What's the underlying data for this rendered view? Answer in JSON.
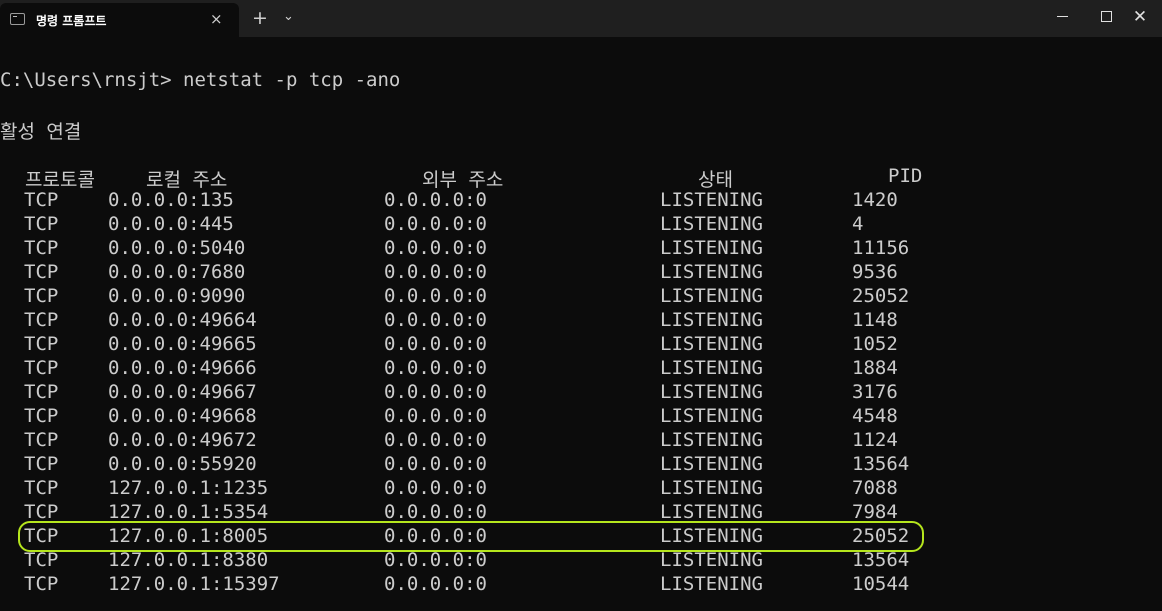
{
  "window": {
    "tab_title": "명령 프롬프트",
    "tab_close": "×",
    "new_tab": "+",
    "dropdown": "⌄",
    "minimize": "–",
    "maximize": "□",
    "close": "✕"
  },
  "terminal": {
    "command_line": "C:\\Users\\rnsjt> netstat -p tcp -ano",
    "section_title": "활성 연결",
    "headers": {
      "proto": "프로토콜",
      "local": "로컬 주소",
      "foreign": "외부 주소",
      "state": "상태",
      "pid": "PID"
    },
    "rows": [
      {
        "proto": "TCP",
        "local": "0.0.0.0:135",
        "foreign": "0.0.0.0:0",
        "state": "LISTENING",
        "pid": "1420"
      },
      {
        "proto": "TCP",
        "local": "0.0.0.0:445",
        "foreign": "0.0.0.0:0",
        "state": "LISTENING",
        "pid": "4"
      },
      {
        "proto": "TCP",
        "local": "0.0.0.0:5040",
        "foreign": "0.0.0.0:0",
        "state": "LISTENING",
        "pid": "11156"
      },
      {
        "proto": "TCP",
        "local": "0.0.0.0:7680",
        "foreign": "0.0.0.0:0",
        "state": "LISTENING",
        "pid": "9536"
      },
      {
        "proto": "TCP",
        "local": "0.0.0.0:9090",
        "foreign": "0.0.0.0:0",
        "state": "LISTENING",
        "pid": "25052"
      },
      {
        "proto": "TCP",
        "local": "0.0.0.0:49664",
        "foreign": "0.0.0.0:0",
        "state": "LISTENING",
        "pid": "1148"
      },
      {
        "proto": "TCP",
        "local": "0.0.0.0:49665",
        "foreign": "0.0.0.0:0",
        "state": "LISTENING",
        "pid": "1052"
      },
      {
        "proto": "TCP",
        "local": "0.0.0.0:49666",
        "foreign": "0.0.0.0:0",
        "state": "LISTENING",
        "pid": "1884"
      },
      {
        "proto": "TCP",
        "local": "0.0.0.0:49667",
        "foreign": "0.0.0.0:0",
        "state": "LISTENING",
        "pid": "3176"
      },
      {
        "proto": "TCP",
        "local": "0.0.0.0:49668",
        "foreign": "0.0.0.0:0",
        "state": "LISTENING",
        "pid": "4548"
      },
      {
        "proto": "TCP",
        "local": "0.0.0.0:49672",
        "foreign": "0.0.0.0:0",
        "state": "LISTENING",
        "pid": "1124"
      },
      {
        "proto": "TCP",
        "local": "0.0.0.0:55920",
        "foreign": "0.0.0.0:0",
        "state": "LISTENING",
        "pid": "13564"
      },
      {
        "proto": "TCP",
        "local": "127.0.0.1:1235",
        "foreign": "0.0.0.0:0",
        "state": "LISTENING",
        "pid": "7088"
      },
      {
        "proto": "TCP",
        "local": "127.0.0.1:5354",
        "foreign": "0.0.0.0:0",
        "state": "LISTENING",
        "pid": "7984"
      },
      {
        "proto": "TCP",
        "local": "127.0.0.1:8005",
        "foreign": "0.0.0.0:0",
        "state": "LISTENING",
        "pid": "25052"
      },
      {
        "proto": "TCP",
        "local": "127.0.0.1:8380",
        "foreign": "0.0.0.0:0",
        "state": "LISTENING",
        "pid": "13564"
      },
      {
        "proto": "TCP",
        "local": "127.0.0.1:15397",
        "foreign": "0.0.0.0:0",
        "state": "LISTENING",
        "pid": "10544"
      }
    ],
    "highlight_color": "#b5e61d",
    "text_color": "#cccccc",
    "background_color": "#0c0c0c"
  }
}
